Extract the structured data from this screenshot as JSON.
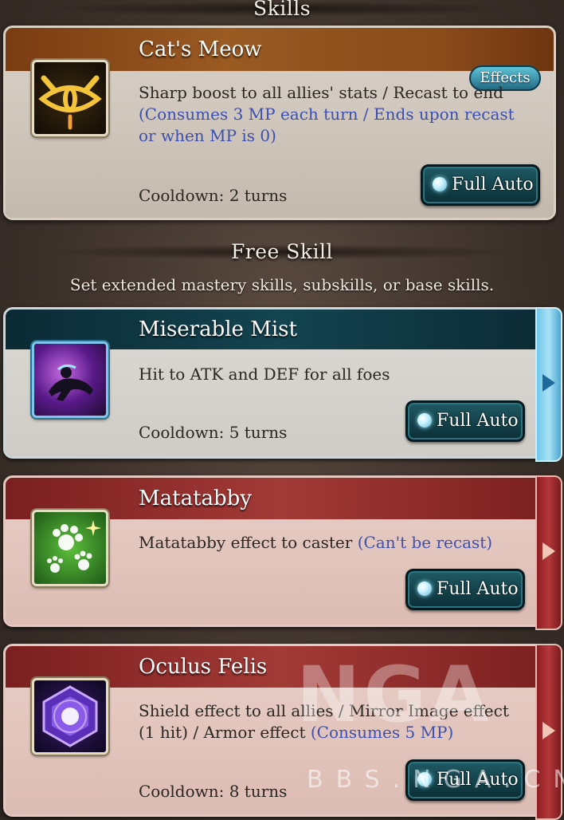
{
  "headers": {
    "skills": "Skills",
    "free_skill": "Free Skill",
    "free_skill_sub": "Set extended mastery skills, subskills, or base skills."
  },
  "cards": [
    {
      "name": "Cat's Meow",
      "desc_plain": "Sharp boost to all allies' stats / Recast to end",
      "desc_blue": "(Consumes 3 MP each turn / Ends upon recast or when MP is 0)",
      "cooldown": "Cooldown: 2 turns",
      "button": "Full Auto",
      "effects": "Effects",
      "icon": "cat-eye-icon",
      "theme": "orange"
    },
    {
      "name": "Miserable Mist",
      "desc_plain": "Hit to ATK and DEF for all foes",
      "desc_blue": "",
      "cooldown": "Cooldown: 5 turns",
      "button": "Full Auto",
      "icon": "collapsed-figure-icon",
      "theme": "blue"
    },
    {
      "name": "Matatabby",
      "desc_plain": "Matatabby effect to caster",
      "desc_blue": "(Can't be recast)",
      "cooldown": "",
      "button": "Full Auto",
      "icon": "paw-prints-icon",
      "theme": "red"
    },
    {
      "name": "Oculus Felis",
      "desc_plain": "Shield effect to all allies / Mirror Image effect (1 hit) / Armor effect",
      "desc_blue": "(Consumes 5 MP)",
      "cooldown": "Cooldown: 8 turns",
      "button": "Full Auto",
      "icon": "purple-hexagon-icon",
      "theme": "red"
    }
  ],
  "watermark": "BBS.NGA.CN",
  "colors": {
    "orange_header": "#8a4a1a",
    "blue_header": "#0e3440",
    "red_header": "#8e2a2a",
    "blue_text": "#3b4fb0"
  }
}
